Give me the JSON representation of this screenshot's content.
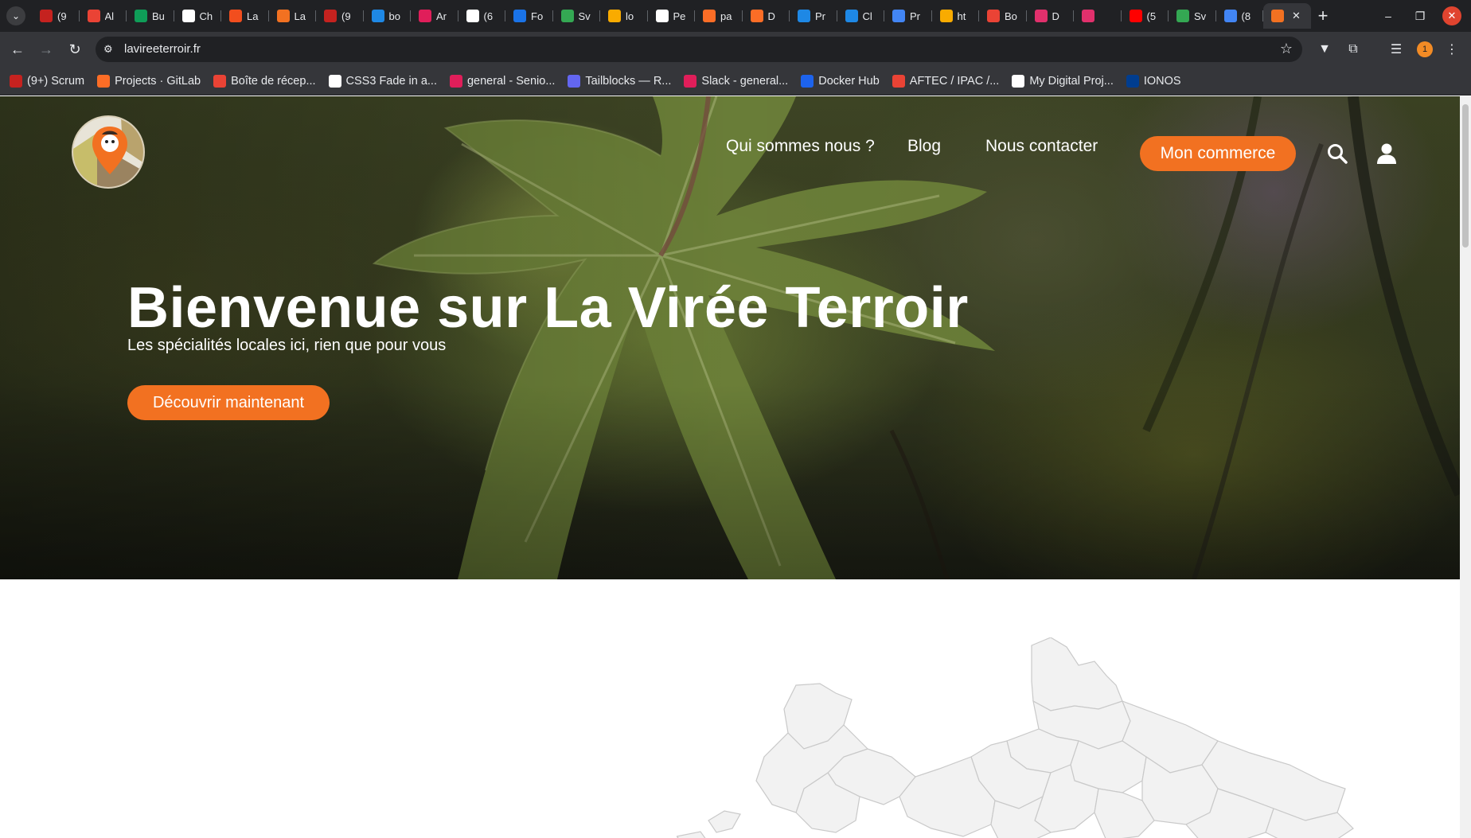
{
  "browser": {
    "tabs": [
      {
        "label": "(9",
        "icon_color": "#c5221f"
      },
      {
        "label": "Al",
        "icon_color": "#ea4335"
      },
      {
        "label": "Bu",
        "icon_color": "#0f9d58"
      },
      {
        "label": "Ch",
        "icon_color": "#ffffff"
      },
      {
        "label": "La",
        "icon_color": "#f24e1e"
      },
      {
        "label": "La",
        "icon_color": "#f27121"
      },
      {
        "label": "(9",
        "icon_color": "#c5221f"
      },
      {
        "label": "bo",
        "icon_color": "#1e88e5"
      },
      {
        "label": "Ar",
        "icon_color": "#e01e5a"
      },
      {
        "label": "(6",
        "icon_color": "#ffffff"
      },
      {
        "label": "Fo",
        "icon_color": "#1a73e8"
      },
      {
        "label": "Sv",
        "icon_color": "#34a853"
      },
      {
        "label": "lo",
        "icon_color": "#f9ab00"
      },
      {
        "label": "Pe",
        "icon_color": "#ffffff"
      },
      {
        "label": "pa",
        "icon_color": "#fc6d26"
      },
      {
        "label": "D",
        "icon_color": "#fc6d26"
      },
      {
        "label": "Pr",
        "icon_color": "#1e88e5"
      },
      {
        "label": "Cl",
        "icon_color": "#1e88e5"
      },
      {
        "label": "Pr",
        "icon_color": "#4285f4"
      },
      {
        "label": "ht",
        "icon_color": "#f9ab00"
      },
      {
        "label": "Bo",
        "icon_color": "#ea4335"
      },
      {
        "label": "D",
        "icon_color": "#e1306c"
      },
      {
        "label": "",
        "icon_color": "#e1306c"
      },
      {
        "label": "(5",
        "icon_color": "#ff0000"
      },
      {
        "label": "Sv",
        "icon_color": "#34a853"
      },
      {
        "label": "(8",
        "icon_color": "#4285f4"
      }
    ],
    "active_tab": {
      "icon_color": "#f27121",
      "close": "✕"
    },
    "new_tab": "+",
    "address": "lavireeterroir.fr",
    "profile_badge": "1",
    "bookmarks": [
      {
        "label": "(9+) Scrum",
        "icon_color": "#c5221f"
      },
      {
        "label": "Projects · GitLab",
        "icon_color": "#fc6d26"
      },
      {
        "label": "Boîte de récep...",
        "icon_color": "#ea4335"
      },
      {
        "label": "CSS3 Fade in a...",
        "icon_color": "#ffffff"
      },
      {
        "label": "general - Senio...",
        "icon_color": "#e01e5a"
      },
      {
        "label": "Tailblocks — R...",
        "icon_color": "#6366f1"
      },
      {
        "label": "Slack - general...",
        "icon_color": "#e01e5a"
      },
      {
        "label": "Docker Hub",
        "icon_color": "#1d63ed"
      },
      {
        "label": "AFTEC / IPAC /...",
        "icon_color": "#ea4335"
      },
      {
        "label": "My Digital Proj...",
        "icon_color": "#ffffff"
      },
      {
        "label": "IONOS",
        "icon_color": "#003d8f"
      }
    ]
  },
  "site": {
    "nav": {
      "about": "Qui sommes nous ?",
      "blog": "Blog",
      "contact": "Nous contacter",
      "cta": "Mon commerce"
    },
    "hero": {
      "title": "Bienvenue sur La Virée Terroir",
      "subtitle": "Les spécialités locales ici, rien que pour vous",
      "cta": "Découvrir maintenant"
    },
    "colors": {
      "accent": "#f27121"
    }
  }
}
